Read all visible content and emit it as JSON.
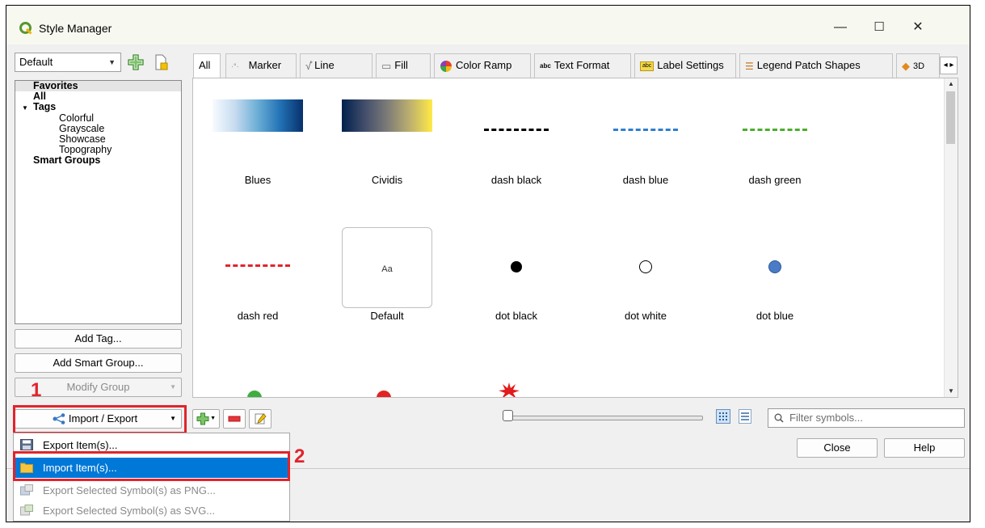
{
  "window": {
    "title": "Style Manager"
  },
  "window_controls": {
    "minimize": "—",
    "maximize": "☐",
    "close": "✕"
  },
  "library": {
    "selected": "Default"
  },
  "tree": {
    "favorites": "Favorites",
    "all": "All",
    "tags": "Tags",
    "tag_items": [
      "Colorful",
      "Grayscale",
      "Showcase",
      "Topography"
    ],
    "smart_groups": "Smart Groups"
  },
  "left_buttons": {
    "add_tag": "Add Tag...",
    "add_smart_group": "Add Smart Group...",
    "modify_group": "Modify Group",
    "import_export": "Import / Export"
  },
  "tabs": [
    "All",
    "Marker",
    "Line",
    "Fill",
    "Color Ramp",
    "Text Format",
    "Label Settings",
    "Legend Patch Shapes",
    "3D"
  ],
  "items": [
    {
      "label": "Blues"
    },
    {
      "label": "Cividis"
    },
    {
      "label": "dash  black"
    },
    {
      "label": "dash blue"
    },
    {
      "label": "dash green"
    },
    {
      "label": "dash red"
    },
    {
      "label": "Default",
      "preview_text": "Aa"
    },
    {
      "label": "dot  black"
    },
    {
      "label": "dot  white"
    },
    {
      "label": "dot blue"
    }
  ],
  "filter": {
    "placeholder": "Filter symbols..."
  },
  "dialog_buttons": {
    "close": "Close",
    "help": "Help"
  },
  "menu": {
    "items": [
      {
        "label": "Export Item(s)...",
        "state": "normal"
      },
      {
        "label": "Import Item(s)...",
        "state": "highlighted"
      },
      {
        "label": "Export Selected Symbol(s) as PNG...",
        "state": "disabled"
      },
      {
        "label": "Export Selected Symbol(s) as SVG...",
        "state": "disabled"
      }
    ]
  },
  "annotations": {
    "step1": "1",
    "step2": "2"
  },
  "colors": {
    "annotation_red": "#e0242c",
    "highlight": "#0078d7",
    "qgis_green": "#589632"
  }
}
